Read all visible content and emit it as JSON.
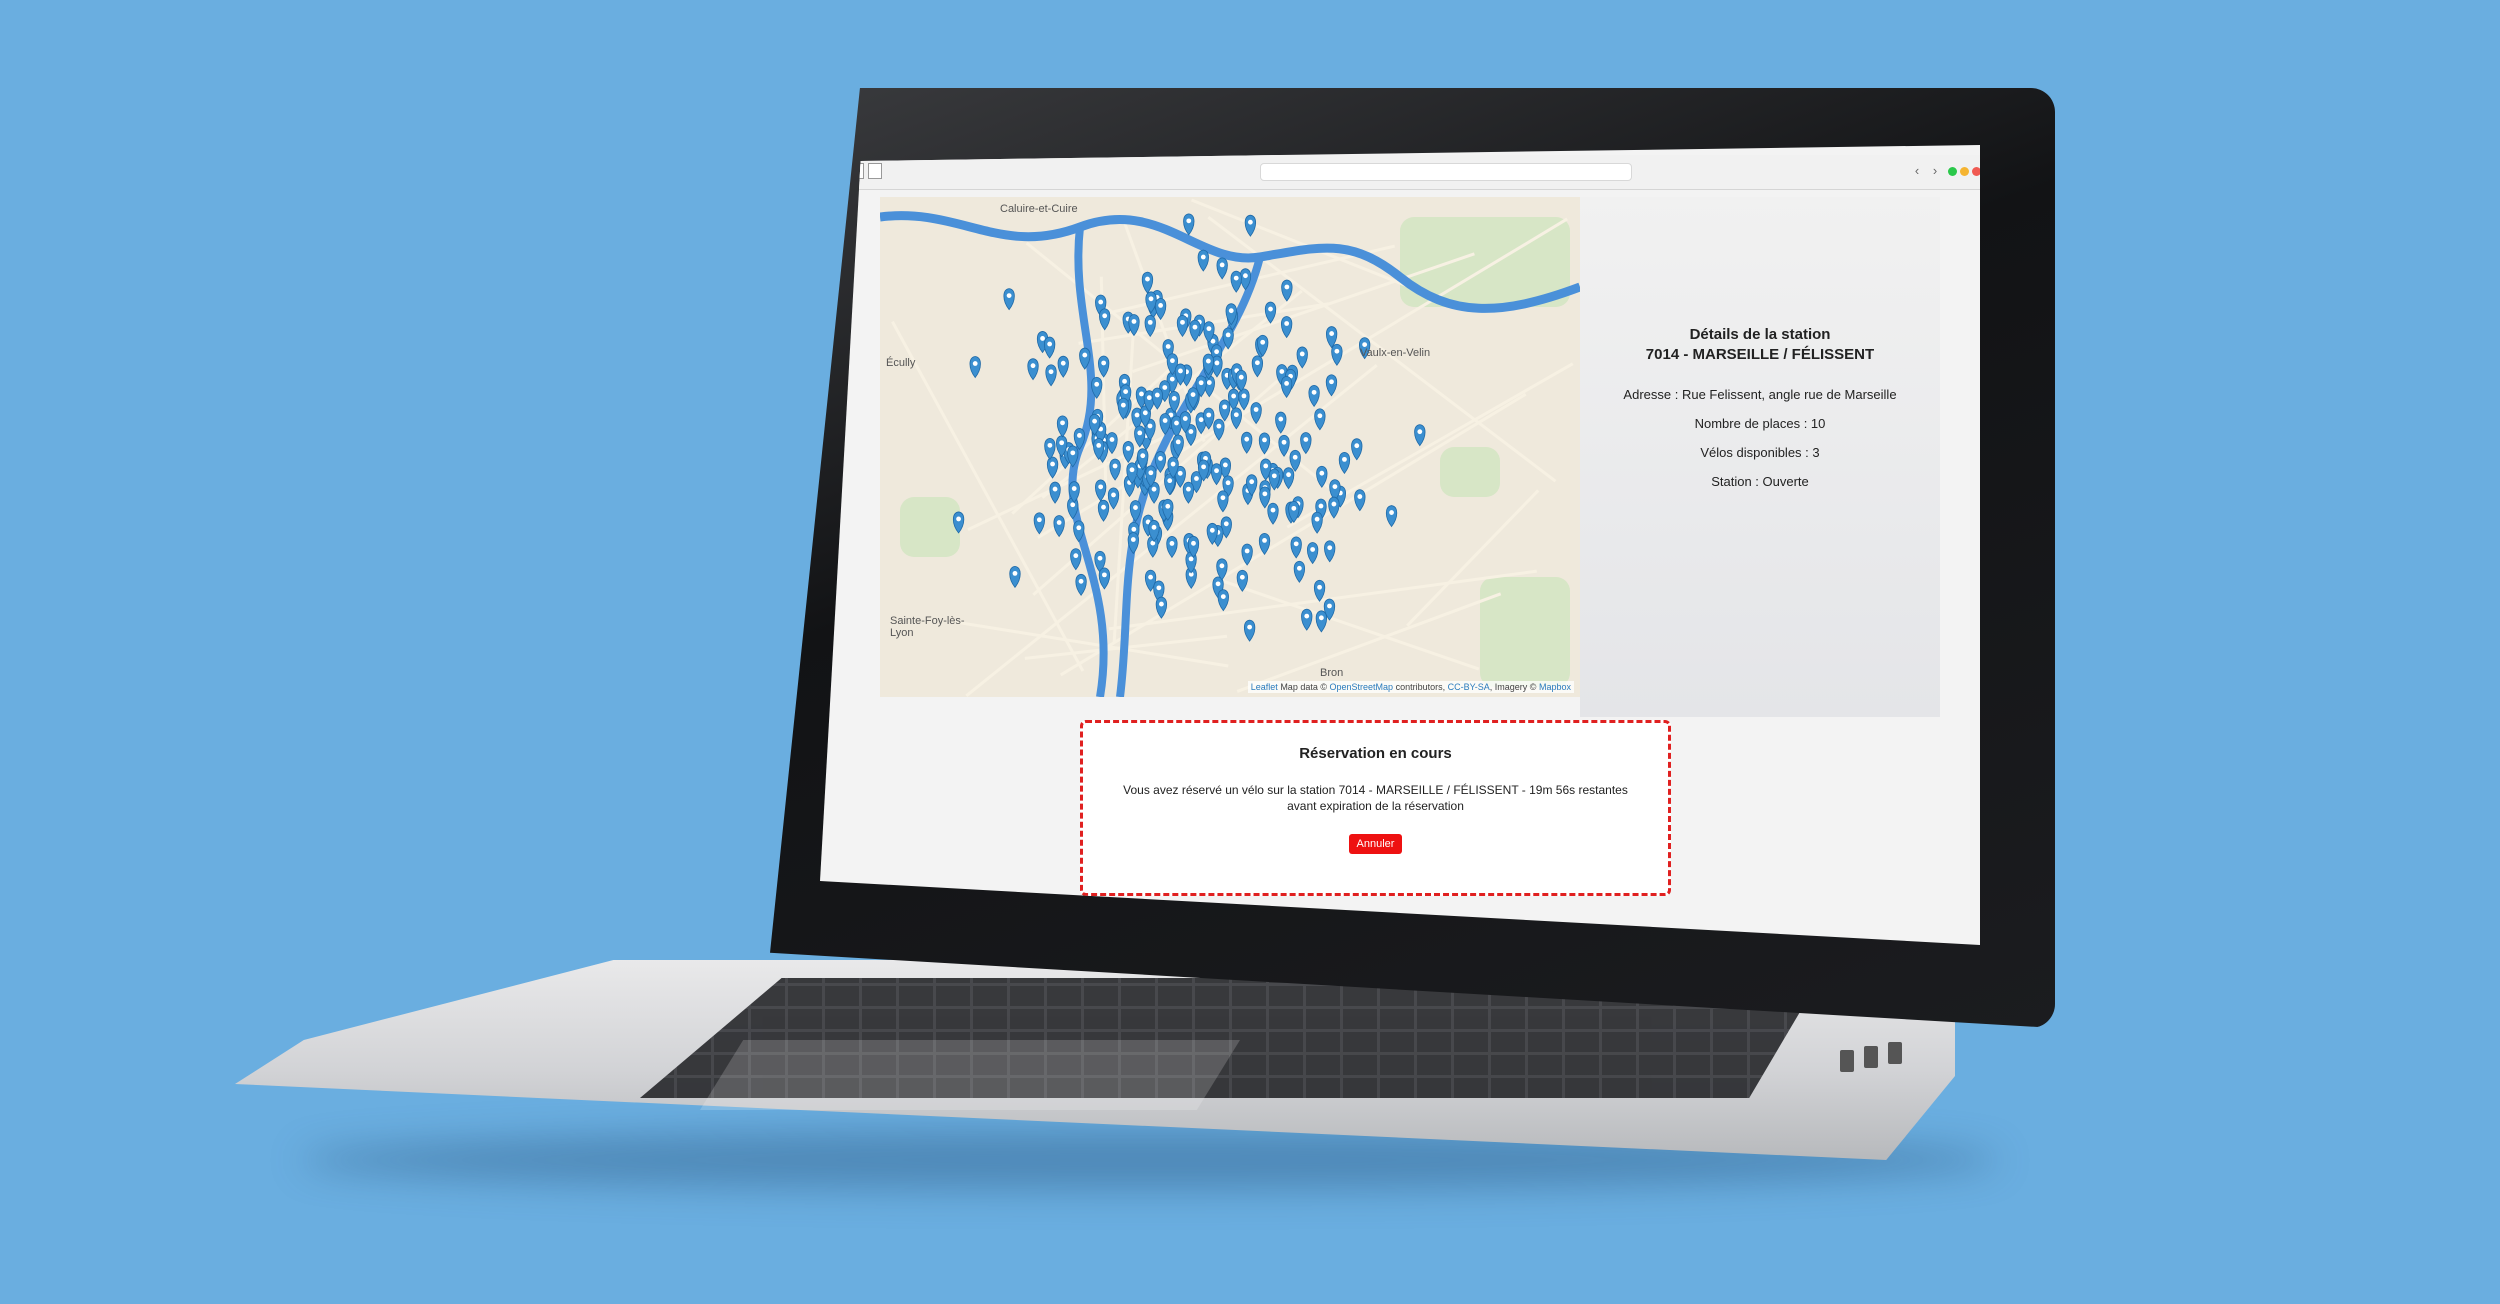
{
  "map": {
    "labels": [
      "Caluire-et-Cuire",
      "Vaulx-en-Velin",
      "Écully",
      "Sainte-Foy-lès-Lyon",
      "Bron"
    ],
    "marker_color": "#3b8fd0",
    "water_color": "#4a90d9",
    "attribution": {
      "leaflet": "Leaflet",
      "map_data_prefix": "Map data ©",
      "osm": "OpenStreetMap",
      "contributors": "contributors,",
      "license": "CC-BY-SA",
      "imagery": ", Imagery ©",
      "mapbox": "Mapbox"
    }
  },
  "details": {
    "heading": "Détails de la station",
    "station_name": "7014 - MARSEILLE / FÉLISSENT",
    "address": "Adresse : Rue Felissent, angle rue de Marseille",
    "places": "Nombre de places : 10",
    "bikes": "Vélos disponibles : 3",
    "status": "Station : Ouverte"
  },
  "reservation": {
    "title": "Réservation en cours",
    "text": "Vous avez réservé un vélo sur la station 7014 - MARSEILLE / FÉLISSENT - 19m 56s restantes avant expiration de la réservation",
    "cancel_label": "Annuler",
    "border_color": "#e02020"
  },
  "browser": {
    "back_icon": "chevron-left-icon",
    "forward_icon": "chevron-right-icon"
  }
}
